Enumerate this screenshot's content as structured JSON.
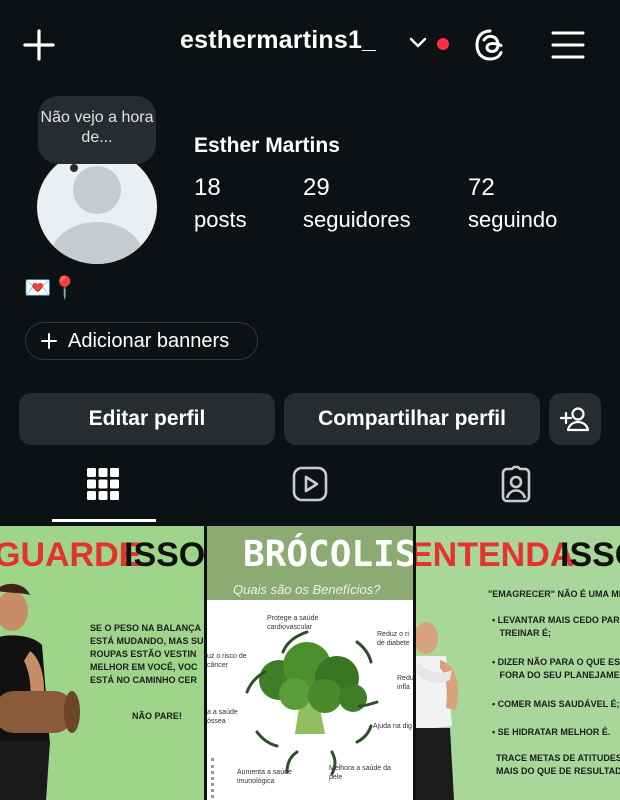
{
  "header": {
    "username": "esthermartins1_",
    "icons": [
      "plus-icon",
      "chevron-down-icon",
      "threads-icon",
      "menu-icon"
    ],
    "notification_color": "#ff2d44"
  },
  "profile": {
    "note_bubble": "Não vejo a hora de...",
    "display_name": "Esther Martins",
    "stats": [
      {
        "value": "18",
        "label": "posts"
      },
      {
        "value": "29",
        "label": "seguidores"
      },
      {
        "value": "72",
        "label": "seguindo"
      }
    ],
    "bio_emojis": "💌📍",
    "add_banners_label": "Adicionar banners"
  },
  "actions": {
    "edit_label": "Editar perfil",
    "share_label": "Compartilhar perfil"
  },
  "tabs": [
    "grid-icon",
    "reels-icon",
    "tagged-icon"
  ],
  "posts": [
    {
      "title_black": "GUARDE",
      "title_red": "ISSO.",
      "lines": "SE O PESO NA BALANÇA\nESTÁ MUDANDO, MAS SU\nROUPAS ESTÃO VESTIN\nMELHOR EM VOCÊ, VOC\nESTÁ NO CAMINHO CER",
      "footer": "NÃO PARE!"
    },
    {
      "title": "BRÓCOLIS",
      "subtitle": "Quais são os Benefícios?",
      "labels": [
        "Protege a saúde\ncardiovascular",
        "Reduz o ri\nde diabete",
        "uz o risco de\ncâncer",
        "Redu\ninfla",
        "a a saúde\nóssea",
        "Ajuda na dig",
        "Aumenta a saúde\nimunológica",
        "Melhora a saúde da\npele"
      ]
    },
    {
      "title_red": "ENTENDA",
      "title_black": "ISSO",
      "intro": "\"EMAGRECER\" NÃO É UMA ME",
      "bullets": [
        "• LEVANTAR MAIS CEDO PARA\n   TREINAR É;",
        "• DIZER NÃO PARA O QUE EST\n   FORA DO SEU PLANEJAMEN",
        "• COMER MAIS SAUDÁVEL É;",
        "• SE HIDRATAR MELHOR É."
      ],
      "footer": "TRACE METAS DE ATITUDES\nMAIS DO QUE DE RESULTAD"
    }
  ]
}
